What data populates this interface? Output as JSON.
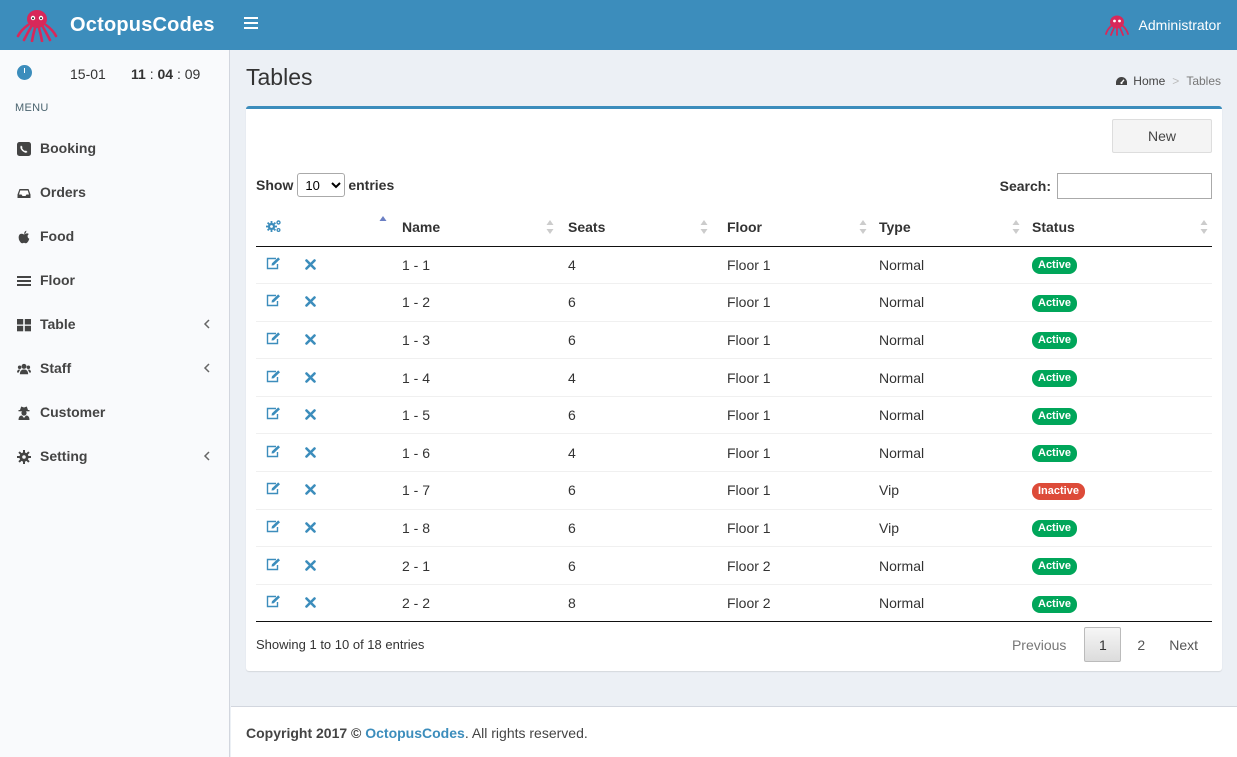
{
  "brand": {
    "name": "OctopusCodes",
    "logo_icon": "octopus-logo"
  },
  "header": {
    "user_name": "Administrator",
    "menu_icon": "hamburger-icon"
  },
  "sidebar": {
    "clock": {
      "date": "15-01",
      "hh": "11",
      "mm": "04",
      "ss": "09",
      "sep": ":"
    },
    "menu_header": "MENU",
    "items": [
      {
        "label": "Booking",
        "icon": "phone-icon",
        "has_children": false
      },
      {
        "label": "Orders",
        "icon": "inbox-icon",
        "has_children": false
      },
      {
        "label": "Food",
        "icon": "apple-icon",
        "has_children": false
      },
      {
        "label": "Floor",
        "icon": "list-icon",
        "has_children": false
      },
      {
        "label": "Table",
        "icon": "grid-icon",
        "has_children": true
      },
      {
        "label": "Staff",
        "icon": "users-icon",
        "has_children": true
      },
      {
        "label": "Customer",
        "icon": "user-secret-icon",
        "has_children": false
      },
      {
        "label": "Setting",
        "icon": "gear-icon",
        "has_children": true
      }
    ]
  },
  "page": {
    "title": "Tables",
    "breadcrumb": {
      "home": "Home",
      "current": "Tables"
    }
  },
  "toolbar": {
    "new_label": "New"
  },
  "datatable": {
    "show_label": "Show",
    "entries_label": "entries",
    "page_length": "10",
    "page_length_options": [
      "10"
    ],
    "search_label": "Search:",
    "search_value": "",
    "columns": [
      "Name",
      "Seats",
      "Floor",
      "Type",
      "Status"
    ],
    "rows": [
      {
        "name": "1 - 1",
        "seats": "4",
        "floor": "Floor 1",
        "type": "Normal",
        "status": "Active"
      },
      {
        "name": "1 - 2",
        "seats": "6",
        "floor": "Floor 1",
        "type": "Normal",
        "status": "Active"
      },
      {
        "name": "1 - 3",
        "seats": "6",
        "floor": "Floor 1",
        "type": "Normal",
        "status": "Active"
      },
      {
        "name": "1 - 4",
        "seats": "4",
        "floor": "Floor 1",
        "type": "Normal",
        "status": "Active"
      },
      {
        "name": "1 - 5",
        "seats": "6",
        "floor": "Floor 1",
        "type": "Normal",
        "status": "Active"
      },
      {
        "name": "1 - 6",
        "seats": "4",
        "floor": "Floor 1",
        "type": "Normal",
        "status": "Active"
      },
      {
        "name": "1 - 7",
        "seats": "6",
        "floor": "Floor 1",
        "type": "Vip",
        "status": "Inactive"
      },
      {
        "name": "1 - 8",
        "seats": "6",
        "floor": "Floor 1",
        "type": "Vip",
        "status": "Active"
      },
      {
        "name": "2 - 1",
        "seats": "6",
        "floor": "Floor 2",
        "type": "Normal",
        "status": "Active"
      },
      {
        "name": "2 - 2",
        "seats": "8",
        "floor": "Floor 2",
        "type": "Normal",
        "status": "Active"
      }
    ],
    "info": "Showing 1 to 10 of 18 entries",
    "pagination": {
      "previous": "Previous",
      "pages": [
        "1",
        "2"
      ],
      "current": "1",
      "next": "Next"
    }
  },
  "footer": {
    "prefix": "Copyright 2017 ©",
    "brand": "OctopusCodes",
    "suffix": ". All rights reserved."
  },
  "colors": {
    "primary": "#3c8dbc",
    "active": "#00a65a",
    "inactive": "#dd4b39",
    "icon": "#3c8dbc"
  }
}
